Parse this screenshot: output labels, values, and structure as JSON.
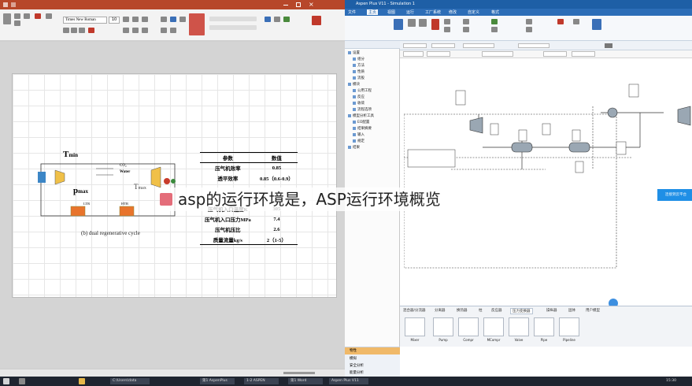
{
  "word": {
    "title_text": "Word document - Word",
    "font_name": "Times New Roman",
    "font_size": "10",
    "figure_caption": "(b) dual regenerative cycle",
    "cycle_labels": {
      "tmin": "T",
      "tmin_sub": "min",
      "pmax": "p",
      "pmax_sub": "max",
      "tmax": "T",
      "tmax_sub": "max",
      "co2": "CO₂",
      "water": "Water",
      "ltr": "LTR",
      "htr": "HTR"
    },
    "table": {
      "headers": [
        "参数",
        "数值"
      ],
      "rows": [
        [
          "压气机效率",
          "0.85"
        ],
        [
          "透平效率",
          "0.85（0.6-0.9）"
        ],
        [
          "",
          ""
        ],
        [
          "",
          ""
        ],
        [
          "压气机入口温度K",
          "305"
        ],
        [
          "压气机入口压力MPa",
          "7.4"
        ],
        [
          "压气机压比",
          "2.6"
        ],
        [
          "质量流量kg/s",
          "2（1-5）"
        ]
      ]
    }
  },
  "aspen": {
    "title_text": "Aspen Plus V11 - Simulation 1",
    "tabs": [
      "文件",
      "主页",
      "视图",
      "运行",
      "工厂系统",
      "修改",
      "自定义",
      "格式"
    ],
    "nav_items": [
      "设置",
      "组分",
      "方法",
      "性质",
      "流股",
      "模块",
      "公用工程",
      "反应",
      "收敛",
      "流程选项",
      "模型分析工具",
      "EO配置",
      "结果摘要",
      "输入",
      "规定",
      "结果"
    ],
    "nav_bottom": [
      "物性",
      "模拟",
      "安全分析",
      "能量分析"
    ],
    "palette_tabs": [
      "混合器/分流器",
      "分离器",
      "换热器",
      "柱",
      "反应器",
      "压力变换器",
      "操纵器",
      "固体",
      "用户模型"
    ],
    "palette_items": [
      "Mixer",
      "Pump",
      "Compr",
      "MCompr",
      "Valve",
      "Pipe",
      "Pipeline"
    ],
    "popup_text": "连接到云平台"
  },
  "caption": "asp的运行环境是，ASP运行环境概览",
  "taskbar": {
    "items": [
      "C:\\Users\\data",
      "第1 AspenPlus",
      "1-2 ASPEN",
      "第1 Word",
      "Aspen Plus V11"
    ],
    "clock": "15:30"
  }
}
